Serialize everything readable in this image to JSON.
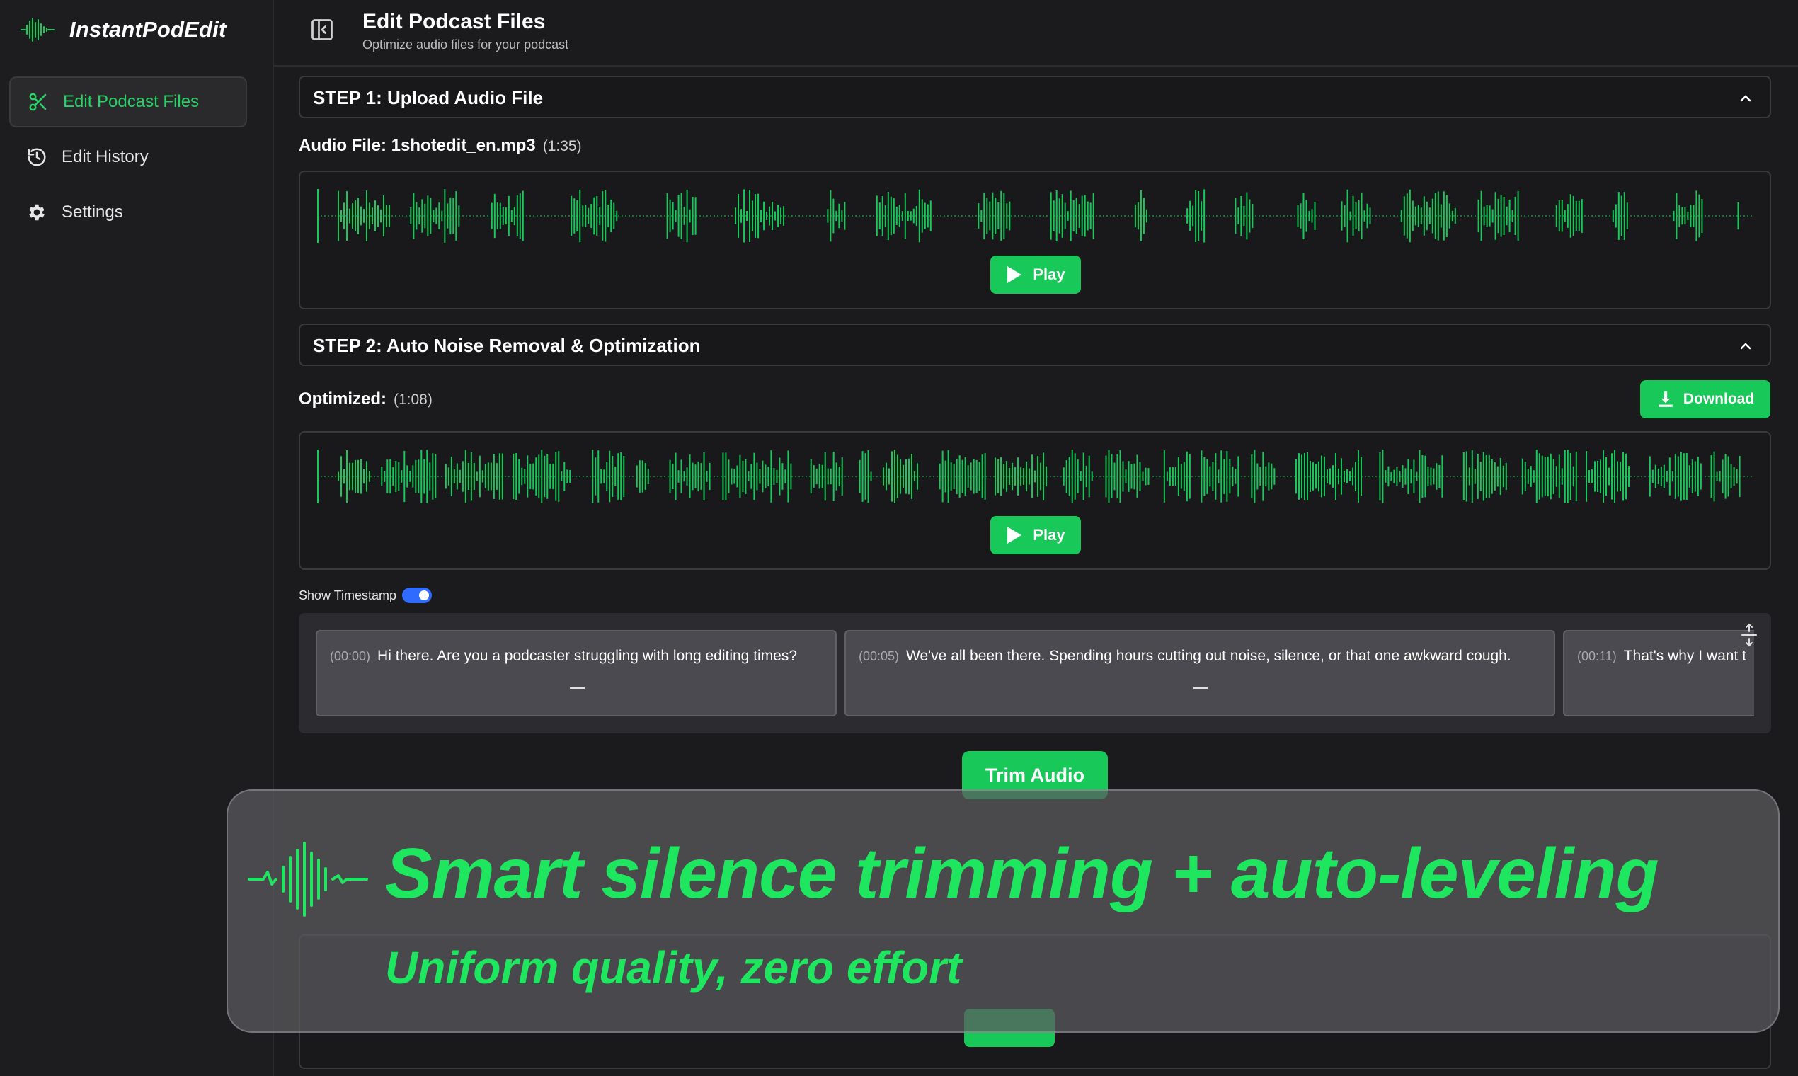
{
  "app": {
    "name": "InstantPodEdit"
  },
  "sidebar": {
    "items": [
      {
        "label": "Edit Podcast Files",
        "icon": "scissors-icon",
        "active": true
      },
      {
        "label": "Edit History",
        "icon": "history-icon",
        "active": false
      },
      {
        "label": "Settings",
        "icon": "gear-icon",
        "active": false
      }
    ]
  },
  "header": {
    "title": "Edit Podcast Files",
    "subtitle": "Optimize audio files for your podcast"
  },
  "step1": {
    "title": "STEP 1: Upload Audio File",
    "file_label": "Audio File: 1shotedit_en.mp3",
    "duration": "(1:35)",
    "play_label": "Play"
  },
  "step2": {
    "title": "STEP 2: Auto Noise Removal & Optimization",
    "optimized_label": "Optimized:",
    "duration": "(1:08)",
    "download_label": "Download",
    "play_label": "Play"
  },
  "timestamps": {
    "toggle_label": "Show Timestamp",
    "enabled": true,
    "segments": [
      {
        "time": "(00:00)",
        "text": "Hi there. Are you a podcaster struggling with long editing times?"
      },
      {
        "time": "(00:05)",
        "text": "We've all been there. Spending hours cutting out noise, silence, or that one awkward cough."
      },
      {
        "time": "(00:11)",
        "text": "That's why I want t"
      }
    ]
  },
  "trim": {
    "label": "Trim Audio"
  },
  "lower": {
    "play_label": "Play"
  },
  "overlay": {
    "headline": "Smart silence trimming + auto-leveling",
    "subline": "Uniform quality, zero effort"
  },
  "colors": {
    "accent": "#18c95a",
    "headline": "#1ee65f",
    "toggle": "#2f6bff",
    "background": "#1b1b1d"
  }
}
